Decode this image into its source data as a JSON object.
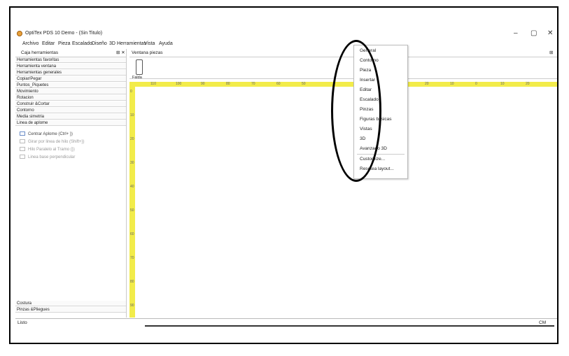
{
  "window": {
    "title": "OptiTex PDS 10 Demo - (Sin Titulo)",
    "minimize": "–",
    "maximize": "▢",
    "close": "✕"
  },
  "menubar": [
    "Archivo",
    "Editar",
    "Pieza",
    "Escalado",
    "Diseño",
    "3D",
    "Herramientas",
    "Vista",
    "Ayuda"
  ],
  "toolbox": {
    "title": "Caja herramientas",
    "pin": "⊞ ✕",
    "categories": [
      "Herramientas favoritas",
      "Herramienta ventana",
      "Herramientas generales",
      "Copiar/Pegar",
      "Puntos_Piquetes",
      "Movimiento",
      "Rotacion",
      "Construir &Cortar",
      "Contorno",
      "Media simetria",
      "Linea de aplome"
    ],
    "tools": [
      "Centrar Aplome (Ctrl+ })",
      "Girar por linea de hilo (Shift+})",
      "Hilo Paralelo al Tramo (})",
      "Linea base perpendicular"
    ],
    "bottom_categories": [
      "Costura",
      "Pinzas &Pliegues"
    ]
  },
  "pieces_window": {
    "title": "Ventana piezas",
    "pin": "⊞",
    "piece_label": "Falda",
    "ruler_top": [
      "110",
      "100",
      "90",
      "80",
      "70",
      "60",
      "50",
      "20",
      "10",
      "0",
      "10",
      "20"
    ],
    "ruler_left": [
      "0",
      "10",
      "20",
      "30",
      "40",
      "50",
      "60",
      "70",
      "80",
      "90"
    ]
  },
  "context_menu": {
    "items": [
      "General",
      "Contorno",
      "Pieza",
      "Insertar",
      "Editar",
      "Escalado",
      "Pinzas",
      "Figuras basicas",
      "Vistas",
      "3D",
      "Avanzado 3D",
      "Customize...",
      "Resetea layout..."
    ]
  },
  "status": {
    "left": "Listo",
    "right": "CM"
  }
}
